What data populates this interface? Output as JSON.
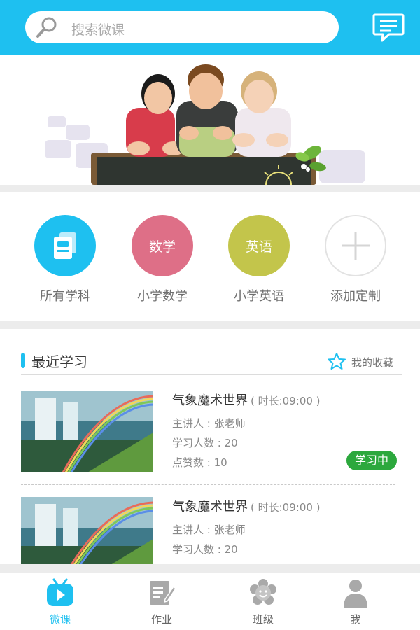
{
  "search": {
    "placeholder": "搜索微课",
    "icon": "search-icon"
  },
  "header": {
    "message_icon": "message-icon"
  },
  "categories": [
    {
      "label": "所有学科",
      "circle_text": "",
      "icon": "book-icon",
      "color": "#1ec0f0"
    },
    {
      "label": "小学数学",
      "circle_text": "数学",
      "icon": "",
      "color": "#de6f87"
    },
    {
      "label": "小学英语",
      "circle_text": "英语",
      "icon": "",
      "color": "#c3c54b"
    },
    {
      "label": "添加定制",
      "circle_text": "",
      "icon": "plus-icon",
      "color": "#ffffff"
    }
  ],
  "recent": {
    "title": "最近学习",
    "favorites_label": "我的收藏",
    "items": [
      {
        "title": "气象魔术世界",
        "duration": "( 时长:09:00 )",
        "teacher": "主讲人 : 张老师",
        "learners": "学习人数 : 20",
        "likes": "点赞数 :  10",
        "status": "学习中"
      },
      {
        "title": "气象魔术世界",
        "duration": "( 时长:09:00 )",
        "teacher": "主讲人 : 张老师",
        "learners": "学习人数 : 20"
      }
    ]
  },
  "tabs": [
    {
      "label": "微课",
      "icon": "tv-play-icon",
      "active": true
    },
    {
      "label": "作业",
      "icon": "homework-icon",
      "active": false
    },
    {
      "label": "班级",
      "icon": "class-flower-icon",
      "active": false
    },
    {
      "label": "我",
      "icon": "user-icon",
      "active": false
    }
  ],
  "colors": {
    "accent": "#1ec0f0",
    "status": "#2ca83d"
  }
}
